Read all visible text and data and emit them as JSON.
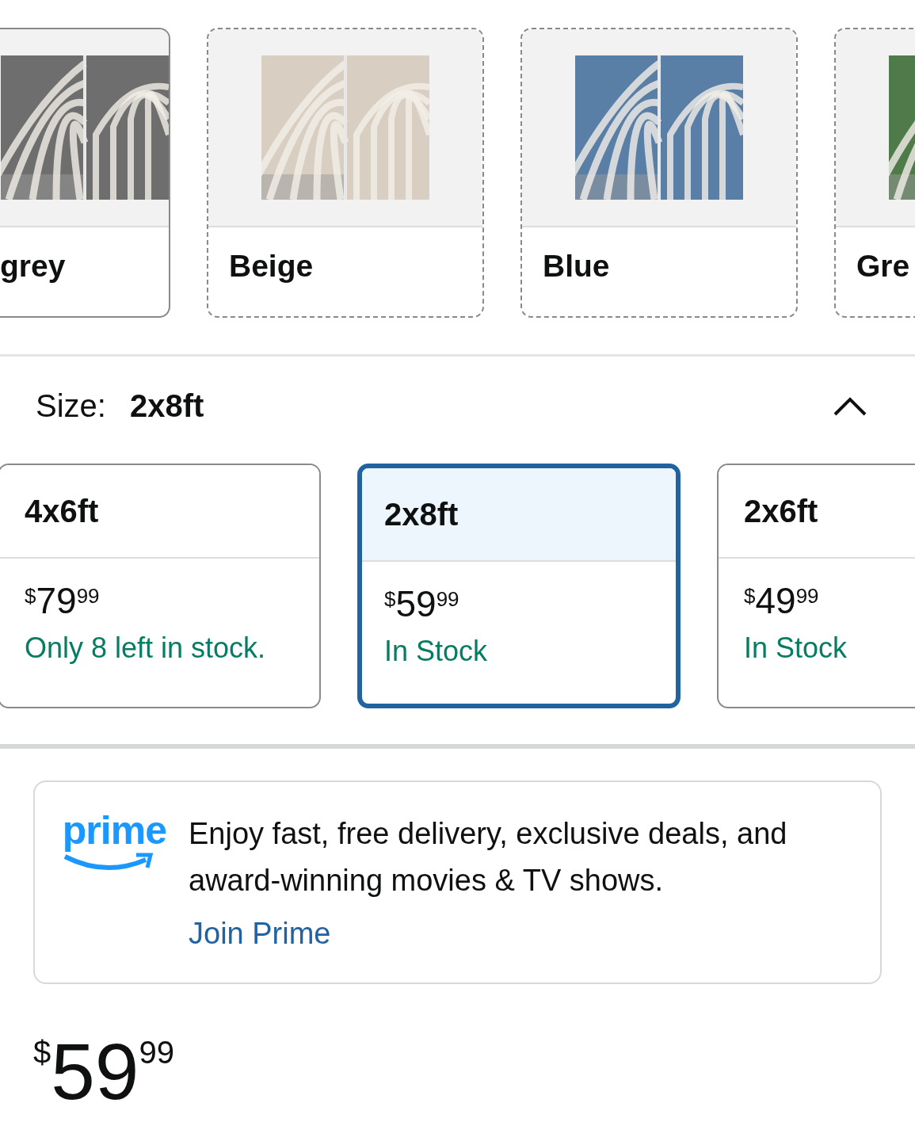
{
  "color_options": [
    {
      "label": "grey",
      "available": true,
      "color": "#6e6e6e"
    },
    {
      "label": "Beige",
      "available": false,
      "color": "#d8cfc2"
    },
    {
      "label": "Blue",
      "available": false,
      "color": "#5a7fa6"
    },
    {
      "label": "Gre",
      "available": false,
      "color": "#4f7a4a"
    }
  ],
  "size": {
    "label": "Size:",
    "value": "2x8ft",
    "expanded": true
  },
  "size_options": [
    {
      "label": "4x6ft",
      "selected": false,
      "price": {
        "symbol": "$",
        "whole": "79",
        "fraction": "99"
      },
      "stock": "Only 8 left in stock."
    },
    {
      "label": "2x8ft",
      "selected": true,
      "price": {
        "symbol": "$",
        "whole": "59",
        "fraction": "99"
      },
      "stock": "In Stock"
    },
    {
      "label": "2x6ft",
      "selected": false,
      "price": {
        "symbol": "$",
        "whole": "49",
        "fraction": "99"
      },
      "stock": "In Stock"
    }
  ],
  "prime_banner": {
    "logo": "prime",
    "text": "Enjoy fast, free delivery, exclusive deals, and award-winning movies & TV shows.",
    "link": "Join Prime"
  },
  "price": {
    "symbol": "$",
    "whole": "59",
    "fraction": "99"
  }
}
